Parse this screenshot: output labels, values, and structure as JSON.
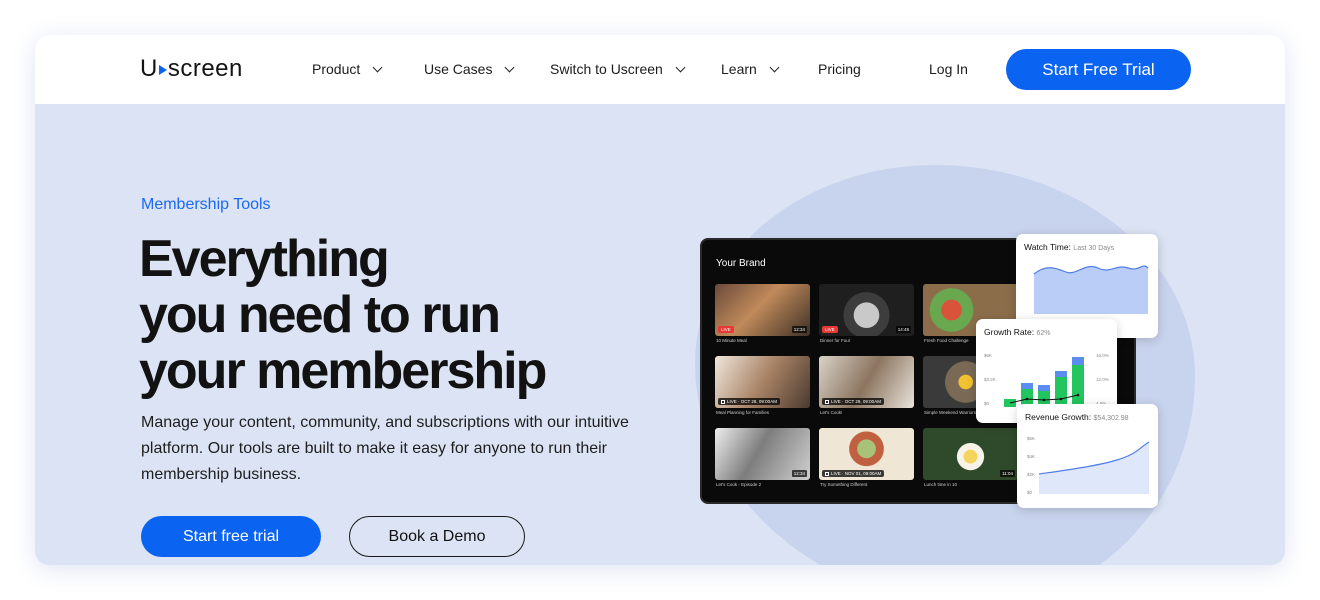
{
  "nav": {
    "logo": {
      "before": "U",
      "after": "screen"
    },
    "items": [
      {
        "label": "Product",
        "has_dropdown": true
      },
      {
        "label": "Use Cases",
        "has_dropdown": true
      },
      {
        "label": "Switch to Uscreen",
        "has_dropdown": true
      },
      {
        "label": "Learn",
        "has_dropdown": true
      },
      {
        "label": "Pricing",
        "has_dropdown": false
      }
    ],
    "login": "Log In",
    "cta": "Start Free Trial"
  },
  "hero": {
    "eyebrow": "Membership Tools",
    "headline": [
      "Everything",
      "you need to run",
      "your membership"
    ],
    "subtext": "Manage your content, community, and subscriptions with our intuitive platform. Our tools are built to make it easy for anyone to run their membership business.",
    "primary_button": "Start free trial",
    "secondary_button": "Book a Demo"
  },
  "device": {
    "title": "Your Brand",
    "videos": [
      {
        "caption": "10 Minute Meal",
        "badge": "LIVE",
        "duration": "12:34"
      },
      {
        "caption": "Dinner for Four",
        "badge": "LIVE",
        "duration": "14:48"
      },
      {
        "caption": "Fresh Food Challenge",
        "badge": "",
        "duration": ""
      },
      {
        "caption": "Meal Planning for Families",
        "badge": "LIVE · OCT 28, 09:00AM",
        "duration": ""
      },
      {
        "caption": "Let's Cook!",
        "badge": "LIVE · OCT 29, 09:00AM",
        "duration": ""
      },
      {
        "caption": "Simple Weekend Warriors",
        "badge": "",
        "duration": ""
      },
      {
        "caption": "Let's Cook - Episode 2",
        "badge": "",
        "duration": "12:34"
      },
      {
        "caption": "Try Something Different",
        "badge": "LIVE · NOV 01, 09:00AM",
        "duration": ""
      },
      {
        "caption": "Lunch time in 10",
        "badge": "",
        "duration": "11:04"
      }
    ]
  },
  "cards": {
    "watch_time": {
      "title": "Watch Time:",
      "sub": "Last 30 Days"
    },
    "growth_rate": {
      "title": "Growth Rate:",
      "sub": "62%",
      "y_left": [
        "$6K",
        "$3.2K",
        "$0"
      ],
      "y_right": [
        "16.0%",
        "12.0%",
        "4.0%"
      ]
    },
    "revenue_growth": {
      "title": "Revenue Growth:",
      "sub": "$54,302.98",
      "y_ticks": [
        "$6K",
        "$4K",
        "$2K",
        "$0"
      ]
    }
  },
  "colors": {
    "brand_blue": "#0b63f2",
    "hero_bg": "#dbe3f4",
    "bar_green": "#22c55e",
    "bar_blue": "#5b8def"
  }
}
